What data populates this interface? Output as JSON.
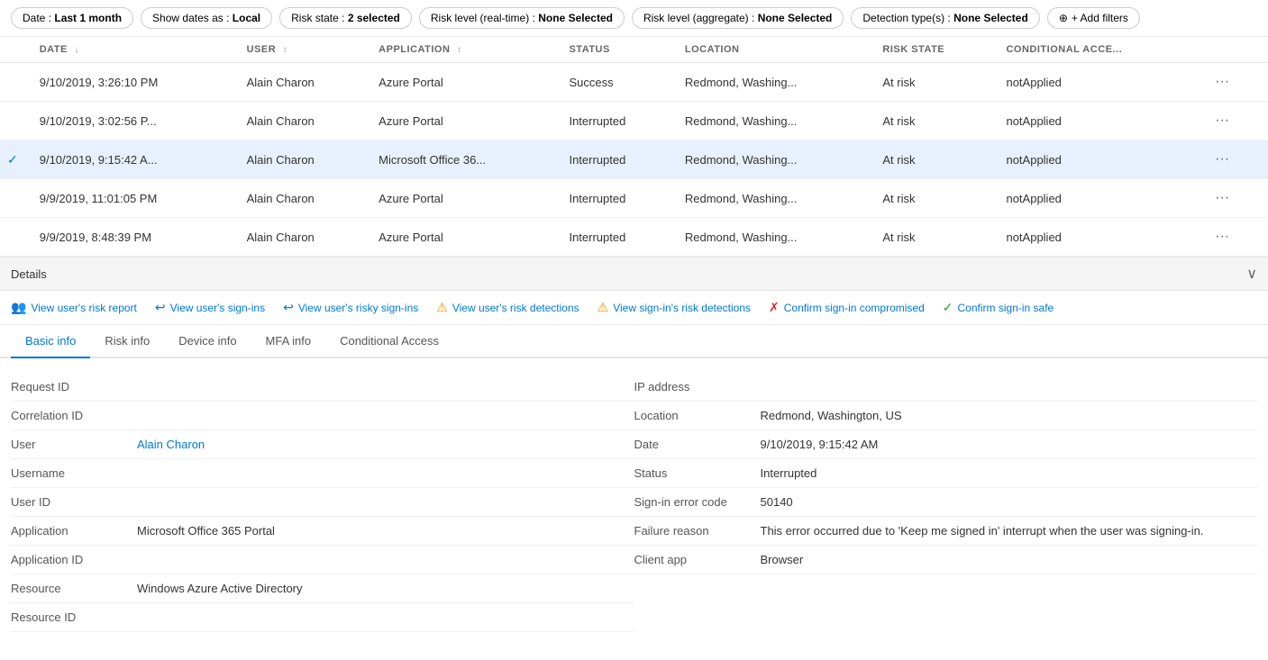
{
  "filters": {
    "date": {
      "label": "Date",
      "value": "Last 1 month"
    },
    "showDates": {
      "label": "Show dates as",
      "value": "Local"
    },
    "riskState": {
      "label": "Risk state",
      "value": "2 selected"
    },
    "riskLevelRealtime": {
      "label": "Risk level (real-time)",
      "value": "None Selected"
    },
    "riskLevelAggregate": {
      "label": "Risk level (aggregate)",
      "value": "None Selected"
    },
    "detectionTypes": {
      "label": "Detection type(s)",
      "value": "None Selected"
    },
    "addFilters": "+ Add filters"
  },
  "table": {
    "columns": [
      {
        "id": "checkbox",
        "label": ""
      },
      {
        "id": "date",
        "label": "Date",
        "sortable": true
      },
      {
        "id": "user",
        "label": "User",
        "sortable": true
      },
      {
        "id": "application",
        "label": "Application",
        "sortable": true
      },
      {
        "id": "status",
        "label": "Status"
      },
      {
        "id": "location",
        "label": "Location"
      },
      {
        "id": "riskState",
        "label": "Risk State"
      },
      {
        "id": "conditionalAccess",
        "label": "Conditional Acce..."
      },
      {
        "id": "actions",
        "label": ""
      }
    ],
    "rows": [
      {
        "id": 1,
        "selected": false,
        "date": "9/10/2019, 3:26:10 PM",
        "user": "Alain Charon",
        "application": "Azure Portal",
        "status": "Success",
        "location": "Redmond, Washing...",
        "riskState": "At risk",
        "conditionalAccess": "notApplied"
      },
      {
        "id": 2,
        "selected": false,
        "date": "9/10/2019, 3:02:56 P...",
        "user": "Alain Charon",
        "application": "Azure Portal",
        "status": "Interrupted",
        "location": "Redmond, Washing...",
        "riskState": "At risk",
        "conditionalAccess": "notApplied"
      },
      {
        "id": 3,
        "selected": true,
        "date": "9/10/2019, 9:15:42 A...",
        "user": "Alain Charon",
        "application": "Microsoft Office 36...",
        "status": "Interrupted",
        "location": "Redmond, Washing...",
        "riskState": "At risk",
        "conditionalAccess": "notApplied"
      },
      {
        "id": 4,
        "selected": false,
        "date": "9/9/2019, 11:01:05 PM",
        "user": "Alain Charon",
        "application": "Azure Portal",
        "status": "Interrupted",
        "location": "Redmond, Washing...",
        "riskState": "At risk",
        "conditionalAccess": "notApplied"
      },
      {
        "id": 5,
        "selected": false,
        "date": "9/9/2019, 8:48:39 PM",
        "user": "Alain Charon",
        "application": "Azure Portal",
        "status": "Interrupted",
        "location": "Redmond, Washing...",
        "riskState": "At risk",
        "conditionalAccess": "notApplied"
      }
    ]
  },
  "details": {
    "barLabel": "Details",
    "chevron": "∨"
  },
  "actionLinks": [
    {
      "id": "view-risk-report",
      "icon": "👥",
      "label": "View user's risk report"
    },
    {
      "id": "view-sign-ins",
      "icon": "↩",
      "label": "View user's sign-ins"
    },
    {
      "id": "view-risky-sign-ins",
      "icon": "↩",
      "label": "View user's risky sign-ins"
    },
    {
      "id": "view-risk-detections",
      "icon": "⚠",
      "label": "View user's risk detections"
    },
    {
      "id": "view-sign-in-risk-detections",
      "icon": "⚠",
      "label": "View sign-in's risk detections"
    },
    {
      "id": "confirm-compromised",
      "icon": "✗",
      "label": "Confirm sign-in compromised"
    },
    {
      "id": "confirm-safe",
      "icon": "✓",
      "label": "Confirm sign-in safe"
    }
  ],
  "tabs": [
    {
      "id": "basic-info",
      "label": "Basic info",
      "active": true
    },
    {
      "id": "risk-info",
      "label": "Risk info",
      "active": false
    },
    {
      "id": "device-info",
      "label": "Device info",
      "active": false
    },
    {
      "id": "mfa-info",
      "label": "MFA info",
      "active": false
    },
    {
      "id": "conditional-access",
      "label": "Conditional Access",
      "active": false
    }
  ],
  "basicInfo": {
    "left": [
      {
        "label": "Request ID",
        "value": ""
      },
      {
        "label": "Correlation ID",
        "value": ""
      },
      {
        "label": "User",
        "value": "Alain Charon",
        "isLink": true
      },
      {
        "label": "Username",
        "value": ""
      },
      {
        "label": "User ID",
        "value": ""
      },
      {
        "label": "Application",
        "value": "Microsoft Office 365 Portal"
      },
      {
        "label": "Application ID",
        "value": ""
      },
      {
        "label": "Resource",
        "value": "Windows Azure Active Directory"
      },
      {
        "label": "Resource ID",
        "value": ""
      }
    ],
    "right": [
      {
        "label": "IP address",
        "value": ""
      },
      {
        "label": "Location",
        "value": "Redmond, Washington, US"
      },
      {
        "label": "Date",
        "value": "9/10/2019, 9:15:42 AM"
      },
      {
        "label": "Status",
        "value": "Interrupted"
      },
      {
        "label": "Sign-in error code",
        "value": "50140"
      },
      {
        "label": "Failure reason",
        "value": "This error occurred due to 'Keep me signed in' interrupt when the user was signing-in."
      },
      {
        "label": "Client app",
        "value": "Browser"
      }
    ]
  }
}
